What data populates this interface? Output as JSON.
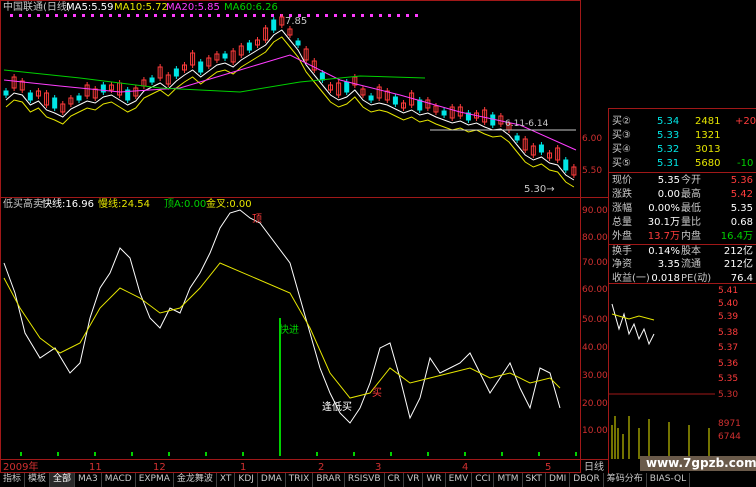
{
  "colors": {
    "bg": "#000000",
    "frame": "#a01818",
    "text": "#c8c8c8",
    "red": "#ff3c3c",
    "green": "#00d000",
    "yellow": "#e6e600",
    "magenta": "#ff3cff",
    "cyan": "#00e6e6",
    "white": "#ffffff"
  },
  "main_header": {
    "stock": "中国联通(日线)",
    "ma5": "MA5:5.59",
    "ma10": "MA10:5.72",
    "ma20": "MA20:5.85",
    "ma60": "MA60:6.26",
    "high_mark": "7.85",
    "range_note": "6.11-6.14",
    "low_mark": "5.30→"
  },
  "main_axis": [
    "6.00",
    "5.50"
  ],
  "indicator_header": {
    "name": "低买高卖",
    "fast": "快线:16.96",
    "slow": "慢线:24.54",
    "top": "顶A:0.00",
    "cross": "金叉:0.00"
  },
  "indicator_axis": [
    "90.00",
    "80.00",
    "70.00",
    "60.00",
    "50.00",
    "40.00",
    "30.00",
    "20.00",
    "10.00"
  ],
  "indicator_labels": {
    "top": "顶",
    "fast_enter": "快进",
    "low_buy": "逢低买",
    "buy": "买"
  },
  "time_axis": {
    "year": "2009年",
    "months": [
      "11",
      "12",
      "1",
      "2",
      "3",
      "4",
      "5"
    ],
    "period": "日线"
  },
  "quote": {
    "bids": [
      {
        "label": "买②",
        "price": "5.34",
        "vol": "2481",
        "chg": "+20"
      },
      {
        "label": "买③",
        "price": "5.33",
        "vol": "1321",
        "chg": ""
      },
      {
        "label": "买④",
        "price": "5.32",
        "vol": "3013",
        "chg": ""
      },
      {
        "label": "买⑤",
        "price": "5.31",
        "vol": "5680",
        "chg": "-10"
      }
    ],
    "stats": [
      [
        "现价",
        "5.35",
        "今开",
        "5.36"
      ],
      [
        "涨跌",
        "0.00",
        "最高",
        "5.42"
      ],
      [
        "涨幅",
        "0.00%",
        "最低",
        "5.35"
      ],
      [
        "总量",
        "30.1万",
        "量比",
        "0.68"
      ],
      [
        "外盘",
        "13.7万",
        "内盘",
        "16.4万"
      ],
      [
        "换手",
        "0.14%",
        "股本",
        "212亿"
      ],
      [
        "净资",
        "3.35",
        "流通",
        "212亿"
      ],
      [
        "收益(一)",
        "0.018",
        "PE(动)",
        "76.4"
      ]
    ]
  },
  "mini_axis": [
    "5.41",
    "5.40",
    "5.39",
    "5.38",
    "5.37",
    "5.36",
    "5.35",
    "5.30",
    "8971",
    "6744"
  ],
  "tabs": [
    "指标",
    "模板",
    "全部",
    "MA3",
    "MACD",
    "EXPMA",
    "金龙舞波",
    "XT",
    "KDJ",
    "DMA",
    "TRIX",
    "BRAR",
    "RSISVB",
    "CR",
    "VR",
    "WR",
    "EMV",
    "CCI",
    "MTM",
    "SKT",
    "DMI",
    "DBQR",
    "筹码分布",
    "BIAS-QL"
  ],
  "watermark": "www.7gpzb.com"
}
